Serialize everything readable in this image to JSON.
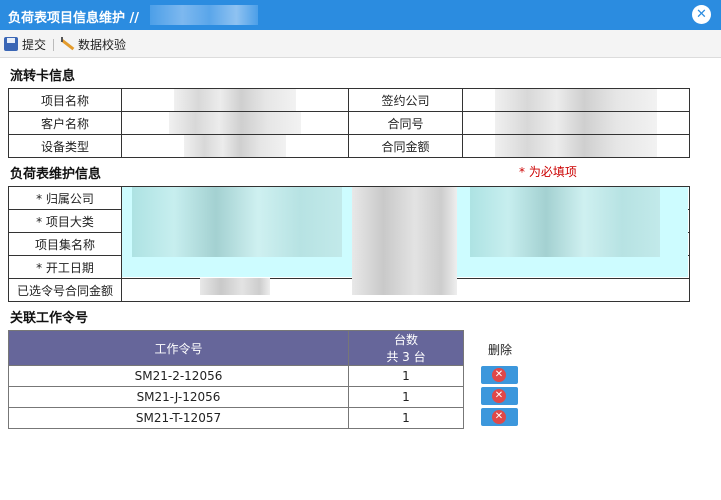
{
  "window": {
    "title": "负荷表项目信息维护 //",
    "close_symbol": "✕"
  },
  "toolbar": {
    "submit_label": "提交",
    "validate_label": "数据校验"
  },
  "flow_card": {
    "section_title": "流转卡信息",
    "labels": {
      "project_name": "项目名称",
      "customer_name": "客户名称",
      "equipment_type": "设备类型",
      "contract_company": "签约公司",
      "contract_no": "合同号",
      "contract_amount": "合同金额"
    }
  },
  "load_table": {
    "section_title": "负荷表维护信息",
    "required_note": "* 为必填项",
    "labels": {
      "belong_company": "* 归属公司",
      "project_category": "* 项目大类",
      "project_set_name": "项目集名称",
      "start_date": "* 开工日期",
      "selected_order_amount": "已选令号合同金额"
    }
  },
  "work_orders": {
    "section_title": "关联工作令号",
    "col_order": "工作令号",
    "col_count": "台数",
    "col_count_total": "共 3 台",
    "delete_header": "删除",
    "rows": [
      {
        "order": "SM21-2-12056",
        "count": "1"
      },
      {
        "order": "SM21-J-12056",
        "count": "1"
      },
      {
        "order": "SM21-T-12057",
        "count": "1"
      }
    ]
  },
  "colors": {
    "titlebar": "#2b8ce0",
    "table_header": "#66669a",
    "required": "#cc0000",
    "input_highlight": "#cdfcff",
    "delete_button": "#3c97dc"
  }
}
